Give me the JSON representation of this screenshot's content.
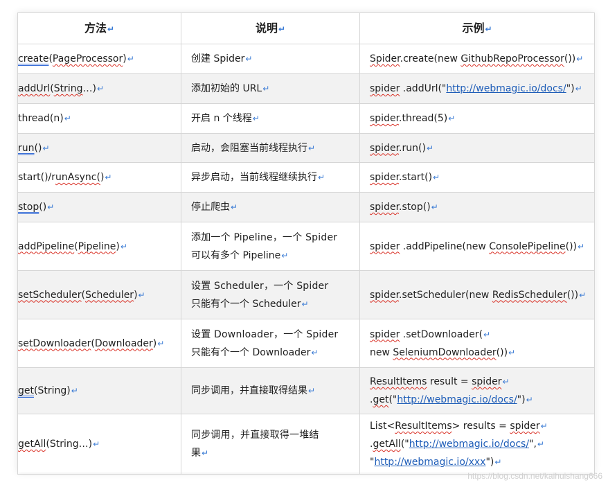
{
  "table": {
    "headers": [
      "方法",
      "说明",
      "示例"
    ],
    "return_mark": "↵",
    "rows": [
      {
        "method": "create(PageProcessor)",
        "desc": [
          "创建 Spider"
        ],
        "example": [
          "Spider.create(new GithubRepoProcessor())"
        ]
      },
      {
        "method": "addUrl(String…)",
        "desc": [
          "添加初始的 URL"
        ],
        "example": [
          "spider .addUrl(\"http://webmagic.io/docs/\")"
        ]
      },
      {
        "method": "thread(n)",
        "desc": [
          "开启 n 个线程"
        ],
        "example": [
          "spider.thread(5)"
        ]
      },
      {
        "method": "run()",
        "desc": [
          "启动，会阻塞当前线程执行"
        ],
        "example": [
          "spider.run()"
        ]
      },
      {
        "method": "start()/runAsync()",
        "desc": [
          "异步启动，当前线程继续执行"
        ],
        "example": [
          "spider.start()"
        ]
      },
      {
        "method": "stop()",
        "desc": [
          "停止爬虫"
        ],
        "example": [
          "spider.stop()"
        ]
      },
      {
        "method": "addPipeline(Pipeline)",
        "desc": [
          "添加一个 Pipeline，一个 Spider",
          "可以有多个 Pipeline"
        ],
        "example": [
          "spider .addPipeline(new ConsolePipeline())"
        ]
      },
      {
        "method": "setScheduler(Scheduler)",
        "desc": [
          "设置 Scheduler，一个 Spider",
          "只能有个一个 Scheduler"
        ],
        "example": [
          "spider.setScheduler(new RedisScheduler())"
        ]
      },
      {
        "method": "setDownloader(Downloader)",
        "desc": [
          "设置 Downloader，一个 Spider",
          "只能有个一个 Downloader"
        ],
        "example": [
          "spider .setDownloader(",
          "new SeleniumDownloader())"
        ]
      },
      {
        "method": "get(String)",
        "desc": [
          "同步调用，并直接取得结果"
        ],
        "example": [
          "ResultItems result = spider",
          ".get(\"http://webmagic.io/docs/\")"
        ]
      },
      {
        "method": "getAll(String…)",
        "desc": [
          "同步调用，并直接取得一堆结",
          "果"
        ],
        "example": [
          "List<ResultItems> results = spider",
          ".getAll(\"http://webmagic.io/docs/\",",
          "\"http://webmagic.io/xxx\")"
        ]
      }
    ]
  },
  "watermark": "https://blog.csdn.net/kaihuishang666"
}
